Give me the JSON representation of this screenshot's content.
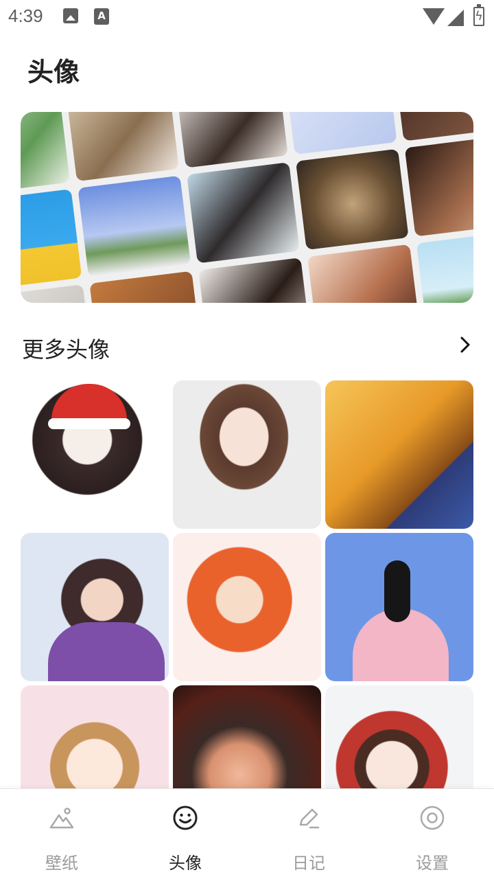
{
  "status_bar": {
    "time": "4:39",
    "icons": [
      "image-icon",
      "a-icon",
      "wifi-icon",
      "signal-icon",
      "battery-charging-icon"
    ]
  },
  "page": {
    "title": "头像"
  },
  "banner": {
    "icon": "photo-collage"
  },
  "section": {
    "title": "更多头像",
    "more_icon": "chevron-right-icon"
  },
  "avatars": [
    {
      "icon": "avatar-christmas-girl"
    },
    {
      "icon": "avatar-bow-girl"
    },
    {
      "icon": "avatar-bucket-hat"
    },
    {
      "icon": "avatar-earmuff-boy"
    },
    {
      "icon": "avatar-red-hood"
    },
    {
      "icon": "avatar-pink-dress"
    },
    {
      "icon": "avatar-curly-girl"
    },
    {
      "icon": "avatar-3d-girl"
    },
    {
      "icon": "avatar-deer-hood"
    }
  ],
  "bottom_nav": {
    "active_color": "#222222",
    "inactive_color": "#9b9b9b",
    "items": [
      {
        "label": "壁纸",
        "icon": "mountain-icon",
        "active": false
      },
      {
        "label": "头像",
        "icon": "smiley-icon",
        "active": true
      },
      {
        "label": "日记",
        "icon": "pencil-icon",
        "active": false
      },
      {
        "label": "设置",
        "icon": "settings-icon",
        "active": false
      }
    ]
  }
}
